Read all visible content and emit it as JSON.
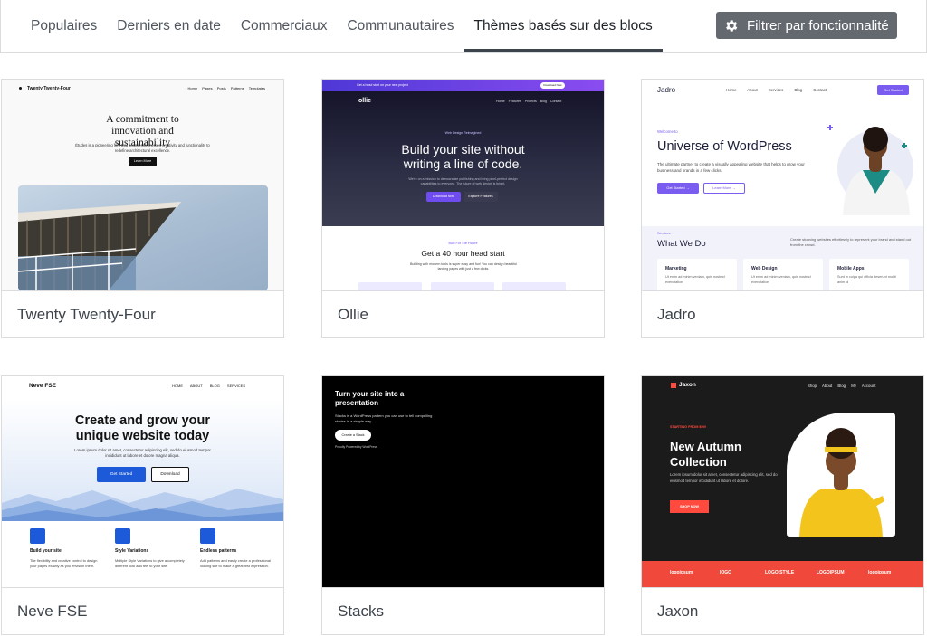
{
  "filter_bar": {
    "tabs": [
      {
        "label": "Populaires"
      },
      {
        "label": "Derniers en date"
      },
      {
        "label": "Commerciaux"
      },
      {
        "label": "Communautaires"
      },
      {
        "label": "Thèmes basés sur des blocs"
      }
    ],
    "active_tab": "Thèmes basés sur des blocs",
    "filter_button": {
      "label": "Filtrer par fonctionnalité",
      "icon": "gear-icon"
    }
  },
  "themes": [
    {
      "name": "Twenty Twenty-Four",
      "preview": {
        "site_title": "Twenty Twenty-Four",
        "nav": "Home Pages Posts Patterns Templates",
        "heading": "A commitment to innovation and sustainability",
        "body": "Études is a pioneering firm that seamlessly merges creativity and functionality to redefine architectural excellence.",
        "cta": "Learn More"
      }
    },
    {
      "name": "Ollie",
      "preview": {
        "banner": "Get a head start on your next project",
        "banner_button": "Download Now",
        "logo": "ollie",
        "nav": "Home Features Projects Blog Contact",
        "eyebrow": "Web Design Reimagined",
        "title": "Build your site without writing a line of code.",
        "subtitle": "We're on a mission to democratize publishing and bring pixel-perfect design capabilities to everyone. The future of web design is bright.",
        "button_primary": "Download Now",
        "button_secondary": "Explore Features",
        "eyebrow2": "Built For The Future",
        "title2": "Get a 40 hour head start",
        "subtitle2": "Building with modern tools is super easy and fun! You can design beautiful landing pages with just a few clicks."
      }
    },
    {
      "name": "Jadro",
      "preview": {
        "logo": "Jadro",
        "nav": "Home About Services Blog Contact",
        "nav_button": "Get Started",
        "eyebrow": "Welcome to",
        "title": "Universe of WordPress",
        "body": "The ultimate partner to create a visually appealing website that helps to grow your business and brands in a few clicks.",
        "button_primary": "Get Started →",
        "button_secondary": "Learn More →",
        "services_eyebrow": "Services",
        "services_title": "What We Do",
        "services_body": "Create stunning websites effortlessly to represent your brand and stand out from the crowd.",
        "services": [
          {
            "title": "Marketing",
            "body": "Ut enim ad minim veniam, quis nostrud exercitation"
          },
          {
            "title": "Web Design",
            "body": "Ut enim ad minim veniam, quis nostrud exercitation"
          },
          {
            "title": "Mobile Apps",
            "body": "Sunt in culpa qui officia deserunt mollit anim id"
          }
        ]
      }
    },
    {
      "name": "Neve FSE",
      "preview": {
        "logo": "Neve FSE",
        "nav": "HOME ABOUT BLOG SERVICES",
        "title": "Create and grow your unique website today",
        "body": "Lorem ipsum dolor sit amet, consectetur adipiscing elit, sed do eiusmod tempor incididunt ut labore et dolore magna aliqua.",
        "button_primary": "Get Started",
        "button_secondary": "Download",
        "features": [
          {
            "title": "Build your site",
            "body": "The flexibility and creative control to design your pages exactly as you envision them."
          },
          {
            "title": "Style Variations",
            "body": "Multiple Style Variations to give a completely different look and feel to your site."
          },
          {
            "title": "Endless patterns",
            "body": "Add patterns and easily create a professional looking site to make a great first impression."
          }
        ]
      }
    },
    {
      "name": "Stacks",
      "preview": {
        "title": "Turn your site into a presentation",
        "body": "Stacks is a WordPress pattern you can use to tell compelling stories in a simple way.",
        "button": "Create a Stack",
        "credit": "Proudly Powered by WordPress"
      }
    },
    {
      "name": "Jaxon",
      "preview": {
        "logo": "Jaxon",
        "nav": "Shop About Blog My Account",
        "eyebrow": "STARTING FROM $99!",
        "title": "New Autumn Collection",
        "body": "Lorem ipsum dolor sit amet, consectetur adipiscing elit, sed do eiusmod tempor incididunt ut labore et dolore.",
        "button": "SHOP NOW",
        "partner_logos": [
          "logoipsum",
          "IOGO",
          "LOGO STYLE",
          "LOGOIPSUM",
          "logoipsum"
        ]
      }
    }
  ],
  "colors": {
    "filter_button_bg": "#646970",
    "active_tab_underline": "#3c434a",
    "ollie_accent": "#6f4cf0",
    "jadro_accent": "#7a5cf0",
    "neve_accent": "#1c5ad9",
    "jaxon_accent": "#f0493c"
  }
}
